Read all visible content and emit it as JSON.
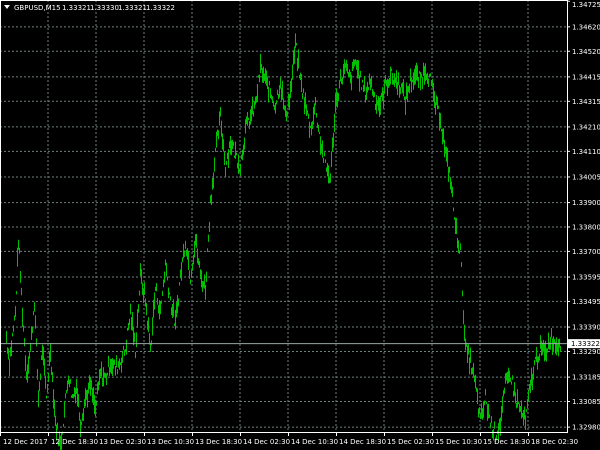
{
  "header": {
    "symbol_label": "GBPUSD,M15",
    "open": "1.33321",
    "high": "1.33330",
    "low": "1.33321",
    "close": "1.33322"
  },
  "chart_data": {
    "type": "bar",
    "instrument": "GBPUSD",
    "timeframe": "M15",
    "ylim": [
      1.3296,
      1.3473
    ],
    "y_ticks": [
      "1.34725",
      "1.34620",
      "1.34520",
      "1.34415",
      "1.34315",
      "1.34210",
      "1.34110",
      "1.34005",
      "1.33900",
      "1.33800",
      "1.33700",
      "1.33595",
      "1.33495",
      "1.33390",
      "1.33290",
      "1.33185",
      "1.33085",
      "1.32980"
    ],
    "x_ticks": [
      "12 Dec 2017",
      "12 Dec 18:30",
      "13 Dec 02:30",
      "13 Dec 10:30",
      "13 Dec 18:30",
      "14 Dec 02:30",
      "14 Dec 10:30",
      "14 Dec 18:30",
      "15 Dec 02:30",
      "15 Dec 10:30",
      "15 Dec 18:30",
      "18 Dec 02:30"
    ],
    "current_price": "1.33322",
    "colors": {
      "bars": "#00c000",
      "grid": "#6f7f7f",
      "axes": "#ffffff",
      "background": "#000000",
      "price_line": "#9aa8a8"
    },
    "series": [
      {
        "waypoints": [
          [
            0,
            1.335
          ],
          [
            3,
            1.3375
          ],
          [
            6,
            1.3335
          ],
          [
            9,
            1.3325
          ],
          [
            12,
            1.3335
          ],
          [
            15,
            1.3345
          ],
          [
            18,
            1.3375
          ],
          [
            22,
            1.3345
          ],
          [
            26,
            1.332
          ],
          [
            30,
            1.333
          ],
          [
            34,
            1.335
          ],
          [
            38,
            1.331
          ],
          [
            42,
            1.333
          ],
          [
            46,
            1.331
          ],
          [
            50,
            1.333
          ],
          [
            55,
            1.33
          ],
          [
            60,
            1.329
          ],
          [
            64,
            1.3305
          ],
          [
            68,
            1.332
          ],
          [
            72,
            1.331
          ],
          [
            76,
            1.3315
          ],
          [
            80,
            1.33
          ],
          [
            85,
            1.331
          ],
          [
            90,
            1.3315
          ],
          [
            95,
            1.3305
          ],
          [
            100,
            1.332
          ],
          [
            105,
            1.3318
          ],
          [
            110,
            1.3325
          ],
          [
            115,
            1.3322
          ],
          [
            120,
            1.3325
          ],
          [
            125,
            1.333
          ],
          [
            130,
            1.3345
          ],
          [
            135,
            1.333
          ],
          [
            140,
            1.336
          ],
          [
            145,
            1.335
          ],
          [
            150,
            1.333
          ],
          [
            155,
            1.3355
          ],
          [
            160,
            1.3345
          ],
          [
            165,
            1.3365
          ],
          [
            170,
            1.335
          ],
          [
            175,
            1.334
          ],
          [
            180,
            1.336
          ],
          [
            185,
            1.3375
          ],
          [
            190,
            1.336
          ],
          [
            195,
            1.3375
          ],
          [
            200,
            1.336
          ],
          [
            205,
            1.3355
          ],
          [
            210,
            1.339
          ],
          [
            215,
            1.341
          ],
          [
            220,
            1.3425
          ],
          [
            225,
            1.3405
          ],
          [
            230,
            1.3415
          ],
          [
            235,
            1.341
          ],
          [
            240,
            1.3405
          ],
          [
            245,
            1.342
          ],
          [
            250,
            1.3425
          ],
          [
            255,
            1.343
          ],
          [
            260,
            1.3445
          ],
          [
            265,
            1.344
          ],
          [
            270,
            1.3435
          ],
          [
            275,
            1.343
          ],
          [
            280,
            1.344
          ],
          [
            285,
            1.3425
          ],
          [
            290,
            1.3435
          ],
          [
            295,
            1.3455
          ],
          [
            300,
            1.344
          ],
          [
            305,
            1.343
          ],
          [
            310,
            1.342
          ],
          [
            315,
            1.343
          ],
          [
            320,
            1.3415
          ],
          [
            325,
            1.3405
          ],
          [
            330,
            1.34
          ],
          [
            335,
            1.343
          ],
          [
            340,
            1.344
          ],
          [
            345,
            1.3445
          ],
          [
            350,
            1.344
          ],
          [
            355,
            1.3448
          ],
          [
            360,
            1.344
          ],
          [
            365,
            1.3435
          ],
          [
            370,
            1.344
          ],
          [
            375,
            1.3432
          ],
          [
            380,
            1.343
          ],
          [
            385,
            1.3438
          ],
          [
            390,
            1.3442
          ],
          [
            395,
            1.344
          ],
          [
            400,
            1.3438
          ],
          [
            405,
            1.3432
          ],
          [
            410,
            1.344
          ],
          [
            415,
            1.3442
          ],
          [
            420,
            1.344
          ],
          [
            425,
            1.3445
          ],
          [
            430,
            1.344
          ],
          [
            435,
            1.343
          ],
          [
            440,
            1.3425
          ],
          [
            445,
            1.341
          ],
          [
            450,
            1.34
          ],
          [
            455,
            1.338
          ],
          [
            460,
            1.337
          ],
          [
            465,
            1.333
          ],
          [
            470,
            1.3325
          ],
          [
            475,
            1.3315
          ],
          [
            480,
            1.33
          ],
          [
            485,
            1.331
          ],
          [
            490,
            1.33
          ],
          [
            495,
            1.3295
          ],
          [
            500,
            1.33
          ],
          [
            505,
            1.3315
          ],
          [
            510,
            1.332
          ],
          [
            515,
            1.331
          ],
          [
            520,
            1.3305
          ],
          [
            525,
            1.33
          ],
          [
            530,
            1.3315
          ],
          [
            535,
            1.3325
          ],
          [
            540,
            1.333
          ],
          [
            545,
            1.3328
          ],
          [
            550,
            1.3335
          ],
          [
            555,
            1.3332
          ],
          [
            560,
            1.3333
          ]
        ]
      }
    ]
  }
}
